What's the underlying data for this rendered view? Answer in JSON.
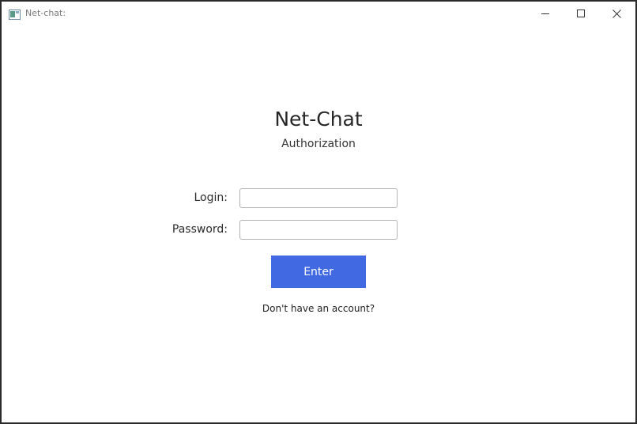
{
  "window": {
    "title": "Net-chat:"
  },
  "header": {
    "app_title": "Net-Chat",
    "subtitle": "Authorization"
  },
  "form": {
    "login_label": "Login:",
    "login_value": "",
    "password_label": "Password:",
    "password_value": "",
    "enter_label": "Enter",
    "register_link": "Don't have an account?"
  },
  "colors": {
    "accent": "#4169e1",
    "border": "#2b2b2b"
  },
  "icons": {
    "app": "app-window-icon",
    "minimize": "minimize-icon",
    "maximize": "maximize-icon",
    "close": "close-icon"
  }
}
